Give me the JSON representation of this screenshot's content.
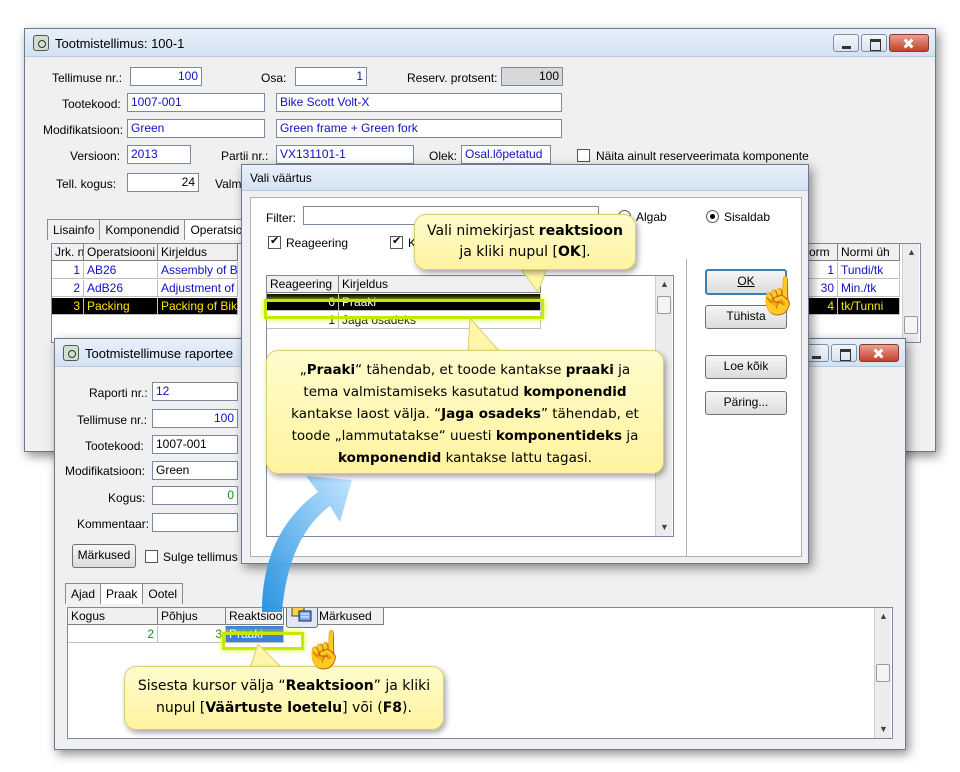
{
  "main_window": {
    "title": "Tootmistellimus: 100-1",
    "labels": {
      "order_no": "Tellimuse nr.:",
      "part": "Osa:",
      "reserve_pct": "Reserv. protsent:",
      "product_code": "Tootekood:",
      "modification": "Modifikatsioon:",
      "version": "Versioon:",
      "batch_no": "Partii nr.:",
      "status": "Olek:",
      "order_qty": "Tell. kogus:",
      "completed_cut": "Valm"
    },
    "values": {
      "order_no": "100",
      "part": "1",
      "reserve_pct": "100",
      "product_code": "1007-001",
      "product_name": "Bike Scott Volt-X",
      "modification": "Green",
      "modification_desc": "Green frame + Green fork",
      "version": "2013",
      "batch_no": "VX131101-1",
      "status": "Osal.lõpetatud",
      "order_qty": "24"
    },
    "show_unreserved_label": "Näita ainult reserveerimata komponente",
    "tabs": [
      "Lisainfo",
      "Komponendid",
      "Operatsioo"
    ],
    "ops_headers": [
      "Jrk. n",
      "Operatsiooni",
      "Kirjeldus"
    ],
    "ops_rows": [
      {
        "nr": "1",
        "op": "AB26",
        "desc": "Assembly of Bik"
      },
      {
        "nr": "2",
        "op": "AdB26",
        "desc": "Adjustment of B"
      },
      {
        "nr": "3",
        "op": "Packing",
        "desc": "Packing of Bike"
      }
    ],
    "ops_right_headers": [
      "orm",
      "Normi üh"
    ],
    "ops_right_rows": [
      {
        "norm": "1",
        "unit": "Tundi/tk"
      },
      {
        "norm": "30",
        "unit": "Min./tk"
      },
      {
        "norm": "4",
        "unit": "tk/Tunni"
      }
    ]
  },
  "report_window": {
    "title": "Tootmistellimuse raportee",
    "labels": {
      "report_no": "Raporti nr.:",
      "order_no": "Tellimuse nr.:",
      "product_code": "Tootekood:",
      "modification": "Modifikatsioon:",
      "qty": "Kogus:",
      "comment": "Kommentaar:"
    },
    "values": {
      "report_no": "12",
      "order_no": "100",
      "product_code": "1007-001",
      "modification": "Green",
      "qty": "0",
      "comment": ""
    },
    "notes_button": "Märkused",
    "close_order_label": "Sulge tellimus",
    "tabs": [
      "Ajad",
      "Praak",
      "Ootel"
    ],
    "scrap_headers": [
      "Kogus",
      "Põhjus",
      "Reaktsioo",
      "Märkused"
    ],
    "scrap_row": {
      "qty": "2",
      "reason": "3",
      "reaction": "Praaki"
    }
  },
  "dialog": {
    "title": "Vali väärtus",
    "filter_label": "Filter:",
    "filter_value": "",
    "starts_label": "Algab",
    "contains_label": "Sisaldab",
    "reaction_check": "Reageering",
    "second_check": "K",
    "headers": [
      "Reageering",
      "Kirjeldus"
    ],
    "rows": [
      {
        "code": "0",
        "desc": "Praaki"
      },
      {
        "code": "1",
        "desc": "Jaga osadeks"
      }
    ],
    "buttons": {
      "ok": "OK",
      "cancel": "Tühista",
      "load_all": "Loe kõik",
      "query": "Päring..."
    }
  },
  "callouts": {
    "top": [
      "Vali nimekirjast ",
      "reaktsioon",
      "ja kliki nupul [",
      "OK",
      "]."
    ],
    "middle": [
      "„",
      "Praaki",
      "“  tähendab, et toode kantakse ",
      "praaki",
      " ja",
      "tema valmistamiseks kasutatud ",
      "komponendid",
      "kantakse laost välja. “",
      "Jaga osadeks",
      "” tähendab, et",
      "toode „lammutatakse“ uuesti ",
      "komponentideks",
      " ja",
      "komponendid",
      "  kantakse lattu tagasi."
    ],
    "bottom": [
      "Sisesta kursor välja “",
      "Reaktsioon",
      "” ja kliki",
      "nupul [",
      "Väärtuste loetelu",
      "] või (",
      "F8",
      ")."
    ]
  },
  "colors": {
    "selected_row_bg": "#000000",
    "selected_row_fg": "#ffe600",
    "link_blue": "#1010c8",
    "callout_bg": "#fff6a8",
    "highlight_green": "#c8e800"
  }
}
